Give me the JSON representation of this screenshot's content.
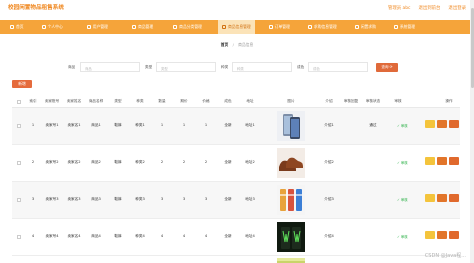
{
  "header": {
    "title": "校园闲置物品租售系统",
    "links": [
      "管理员 abc",
      "退出到前台",
      "退出登录"
    ]
  },
  "nav": {
    "items": [
      {
        "label": "首页",
        "active": false
      },
      {
        "label": "个人中心",
        "active": false
      },
      {
        "label": "用户管理",
        "active": false
      },
      {
        "label": "商品管理",
        "active": false
      },
      {
        "label": "商品分类管理",
        "active": false
      },
      {
        "label": "商品信息管理",
        "active": true
      },
      {
        "label": "订单管理",
        "active": false
      },
      {
        "label": "求购信息管理",
        "active": false
      },
      {
        "label": "闲置求购",
        "active": false
      },
      {
        "label": "系统管理",
        "active": false
      }
    ]
  },
  "breadcrumb": {
    "home": "首页",
    "separator": "/",
    "current": "商品信息"
  },
  "search": {
    "fields": [
      {
        "label": "商品",
        "placeholder": "商品"
      },
      {
        "label": "类型",
        "placeholder": "类型"
      },
      {
        "label": "种类",
        "placeholder": "种类"
      },
      {
        "label": "成色",
        "placeholder": "成色"
      }
    ],
    "button": "查询 ⟳"
  },
  "actions": {
    "add": "新增"
  },
  "table": {
    "headers": [
      "索引",
      "卖家账号",
      "卖家姓名",
      "商品名称",
      "类型",
      "种类",
      "数量",
      "期价",
      "价格",
      "成色",
      "地址",
      "图片",
      "介绍",
      "审核回复",
      "审核状态",
      "审核",
      "操作"
    ],
    "rows": [
      {
        "index": "1",
        "account": "卖家号1",
        "name": "卖家名1",
        "product": "商品1",
        "type": "鞋裤",
        "kind": "种类1",
        "qty": "1",
        "period": "1",
        "price": "1",
        "condition": "全新",
        "addr": "地址1",
        "intro": "介绍1",
        "status": "通过",
        "review": "✓ 审核",
        "image": "phone"
      },
      {
        "index": "2",
        "account": "卖家号2",
        "name": "卖家名2",
        "product": "商品2",
        "type": "鞋裤",
        "kind": "种类2",
        "qty": "2",
        "period": "2",
        "price": "2",
        "condition": "全新",
        "addr": "地址2",
        "intro": "介绍2",
        "status": "",
        "review": "✓ 审核",
        "image": "shoes"
      },
      {
        "index": "3",
        "account": "卖家号3",
        "name": "卖家名3",
        "product": "商品3",
        "type": "鞋裤",
        "kind": "种类3",
        "qty": "3",
        "period": "3",
        "price": "3",
        "condition": "全新",
        "addr": "地址3",
        "intro": "介绍3",
        "status": "",
        "review": "✓ 审核",
        "image": "socks"
      },
      {
        "index": "4",
        "account": "卖家号4",
        "name": "卖家名4",
        "product": "商品4",
        "type": "鞋裤",
        "kind": "种类4",
        "qty": "4",
        "period": "4",
        "price": "4",
        "condition": "全新",
        "addr": "地址4",
        "intro": "介绍4",
        "status": "",
        "review": "✓ 审核",
        "image": "cans"
      }
    ]
  },
  "watermark": "CSDN @Java程..."
}
